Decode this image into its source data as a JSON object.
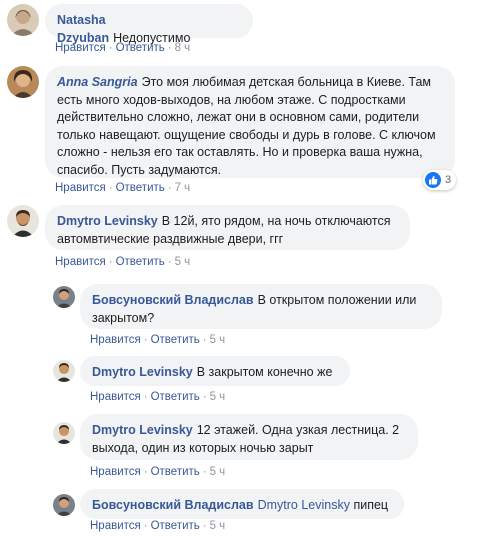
{
  "actions": {
    "like": "Нравится",
    "reply": "Ответить",
    "separator": "·"
  },
  "comments": [
    {
      "author": "Natasha Dzyuban",
      "text": "Недопустимо",
      "time": "8 ч"
    },
    {
      "author": "Anna Sangria",
      "text": "Это моя любимая детская больница в Киеве. Там есть много ходов-выходов, на любом этаже. С подростками действительно сложно, лежат они в основном сами, родители только навещают. ощущение свободы и дурь в голове. С ключом сложно - нельзя его так оставлять. Но и проверка ваша нужна, спасибо. Пусть задумаются.",
      "time": "7 ч",
      "reactions": "3"
    },
    {
      "author": "Dmytro Levinsky",
      "text": "В 12й, ято рядом, на ночь отключаются автомвтические раздвижные двери, ггг",
      "time": "5 ч"
    },
    {
      "author": "Бовсуновский Владислав",
      "text": "В открытом положении или закрытом?",
      "time": "5 ч"
    },
    {
      "author": "Dmytro Levinsky",
      "text": "В закрытом конечно же",
      "time": "5 ч"
    },
    {
      "author": "Dmytro Levinsky",
      "text": "12 этажей. Одна узкая лестница. 2 выхода, один из которых ночью зарыт",
      "time": "5 ч"
    },
    {
      "author": "Бовсуновский Владислав",
      "mention": "Dmytro Levinsky",
      "text": "пипец",
      "time": "5 ч"
    }
  ]
}
